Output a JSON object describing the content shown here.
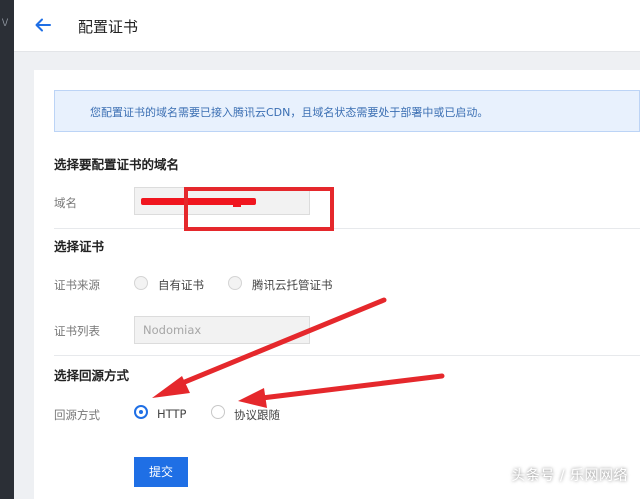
{
  "rail": {
    "glyph": "\\/"
  },
  "header": {
    "title": "配置证书"
  },
  "notice": {
    "text": "您配置证书的域名需要已接入腾讯云CDN，且域名状态需要处于部署中或已启动。"
  },
  "domain_section": {
    "title": "选择要配置证书的域名",
    "field_label": "域名"
  },
  "cert_section": {
    "title": "选择证书",
    "source_label": "证书来源",
    "source_options": [
      "自有证书",
      "腾讯云托管证书"
    ],
    "list_label": "证书列表",
    "list_value": "Nodomiax"
  },
  "origin_section": {
    "title": "选择回源方式",
    "field_label": "回源方式",
    "options": [
      "HTTP",
      "协议跟随"
    ],
    "selected": "HTTP"
  },
  "actions": {
    "submit_label": "提交"
  },
  "watermark": {
    "text": "头条号 / 乐网网络"
  },
  "colors": {
    "accent": "#1f6fe5",
    "annotation_red": "#e5282c"
  }
}
